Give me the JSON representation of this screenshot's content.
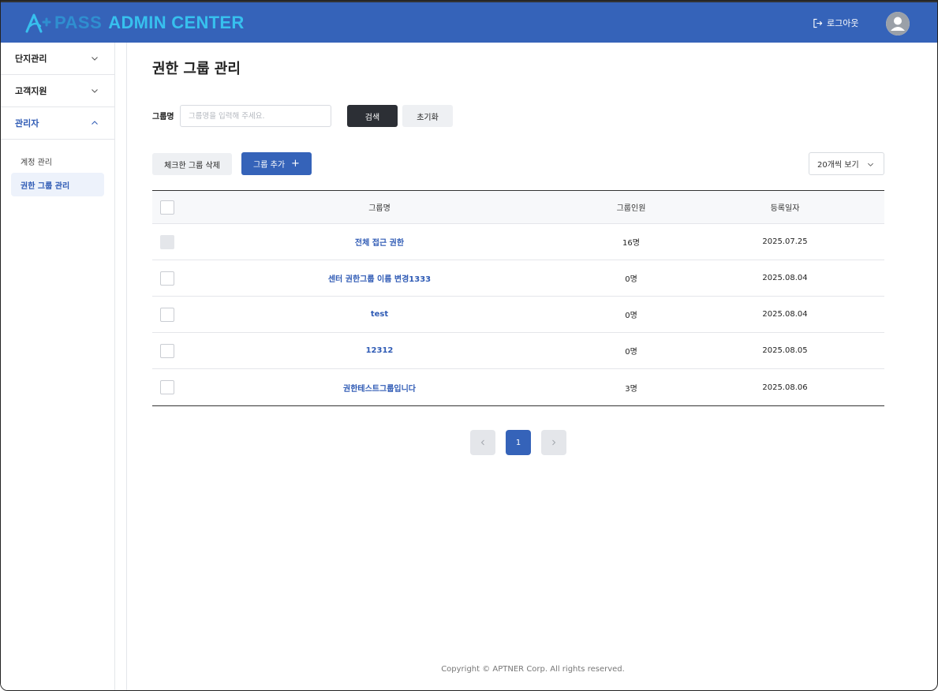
{
  "brand": {
    "logo_pass": "PASS",
    "logo_admin": "ADMIN CENTER",
    "primary_color": "#3563b9",
    "accent_color": "#37c0ee"
  },
  "header": {
    "logout_label": "로그아웃",
    "logout_icon": "logout-icon",
    "avatar_icon": "user-avatar-icon"
  },
  "sidebar": {
    "menus": [
      {
        "label": "단지관리",
        "expanded": false
      },
      {
        "label": "고객지원",
        "expanded": false
      },
      {
        "label": "관리자",
        "expanded": true
      }
    ],
    "sub_items": [
      {
        "label": "계정 관리",
        "active": false
      },
      {
        "label": "권한 그룹 관리",
        "active": true
      }
    ]
  },
  "main": {
    "title": "권한 그룹 관리",
    "search": {
      "label": "그룹명",
      "placeholder": "그룹명을 입력해 주세요.",
      "value": "",
      "search_button": "검색",
      "reset_button": "초기화"
    },
    "actions": {
      "delete_button": "체크한 그룹 삭제",
      "add_button": "그룹 추가",
      "add_symbol": "+",
      "page_size": "20개씩 보기"
    },
    "table": {
      "columns": [
        "그룹명",
        "그룹인원",
        "등록일자"
      ],
      "rows": [
        {
          "name": "전체 접근 권한",
          "count": "16명",
          "date": "2025.07.25",
          "disabled": true
        },
        {
          "name": "센터 권한그룹 이름 변경1333",
          "count": "0명",
          "date": "2025.08.04",
          "disabled": false
        },
        {
          "name": "test",
          "count": "0명",
          "date": "2025.08.04",
          "disabled": false
        },
        {
          "name": "12312",
          "count": "0명",
          "date": "2025.08.05",
          "disabled": false
        },
        {
          "name": "권한테스트그룹입니다",
          "count": "3명",
          "date": "2025.08.06",
          "disabled": false
        }
      ]
    },
    "pagination": {
      "current_page": "1"
    }
  },
  "footer": {
    "copyright": "Copyright © APTNER Corp. All rights reserved."
  }
}
